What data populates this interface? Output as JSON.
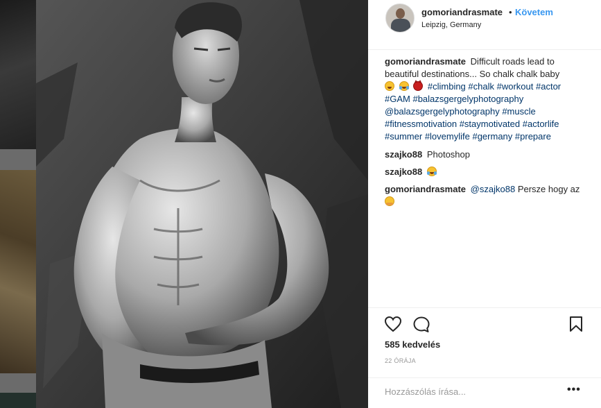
{
  "post": {
    "username": "gomoriandrasmate",
    "separator": "•",
    "follow_label": "Követem",
    "location": "Leipzig, Germany"
  },
  "caption": {
    "user": "gomoriandrasmate",
    "text": "Difficult roads lead to beautiful destinations... So chalk chalk baby",
    "emojis": [
      "grinning-squinting-face",
      "face-with-tears-of-joy",
      "smiling-face-with-horns"
    ],
    "hashtags_line1": [
      "#climbing",
      "#chalk",
      "#workout",
      "#actor"
    ],
    "hashtags_line2": [
      "#GAM",
      "#balazsgergelyphotography"
    ],
    "mention": "@balazsgergelyphotography",
    "hashtags_line3": [
      "#muscle"
    ],
    "hashtags_line4": [
      "#fitnessmotivation",
      "#staymotivated",
      "#actorlife"
    ],
    "hashtags_line5": [
      "#summer",
      "#lovemylife",
      "#germany",
      "#prepare"
    ]
  },
  "comments": [
    {
      "user": "szajko88",
      "text": "Photoshop"
    },
    {
      "user": "szajko88",
      "text": "",
      "emoji": "face-with-tears-of-joy"
    },
    {
      "user": "gomoriandrasmate",
      "mention": "@szajko88",
      "text": "Persze hogy az",
      "emoji": "hugging-face"
    }
  ],
  "actions": {
    "like_icon": "heart-icon",
    "comment_icon": "comment-icon",
    "save_icon": "bookmark-icon",
    "likes_text": "585 kedvelés",
    "timestamp": "22 ÓRÁJA"
  },
  "add_comment": {
    "placeholder": "Hozzászólás írása...",
    "more_label": "•••"
  },
  "colors": {
    "link_blue": "#3897f0",
    "hashtag": "#003569",
    "text": "#262626",
    "muted": "#999999",
    "divider": "#efefef"
  }
}
